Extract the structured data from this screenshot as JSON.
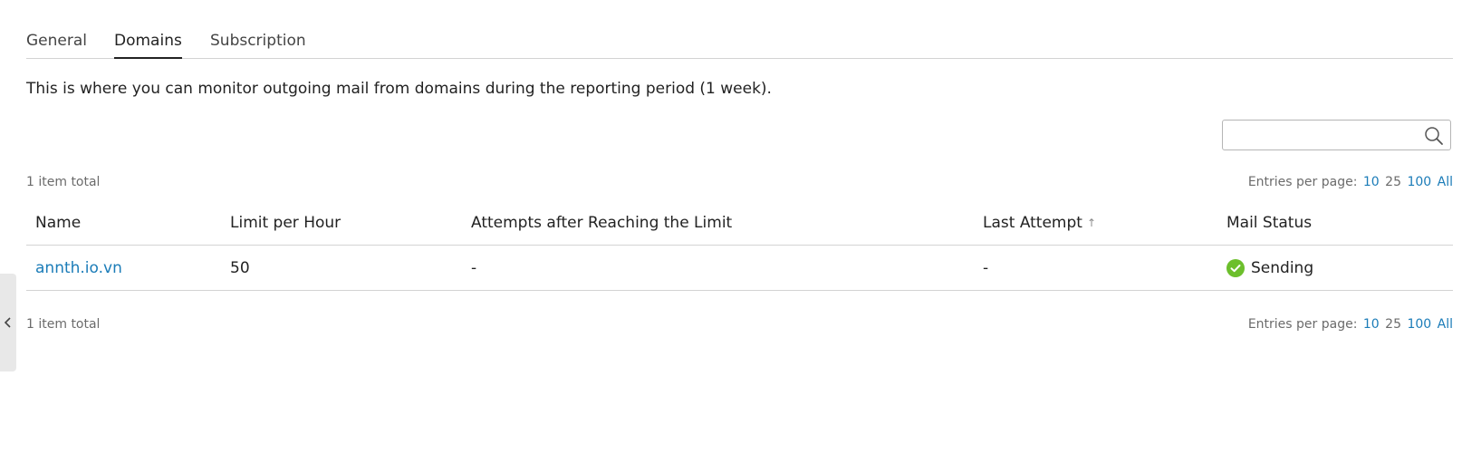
{
  "tabs": [
    {
      "label": "General",
      "active": false
    },
    {
      "label": "Domains",
      "active": true
    },
    {
      "label": "Subscription",
      "active": false
    }
  ],
  "description": "This is where you can monitor outgoing mail from domains during the reporting period (1 week).",
  "search": {
    "value": "",
    "placeholder": "",
    "icon": "search-icon"
  },
  "pager": {
    "total_label": "1 item total",
    "entries_label": "Entries per page:",
    "options": [
      "10",
      "25",
      "100",
      "All"
    ],
    "current": "25"
  },
  "table": {
    "columns": [
      "Name",
      "Limit per Hour",
      "Attempts after Reaching the Limit",
      "Last Attempt",
      "Mail Status"
    ],
    "sorted_column": "Last Attempt",
    "sort_direction": "ascending",
    "sort_icon": "arrow-up-icon",
    "rows": [
      {
        "name": "annth.io.vn",
        "limit_per_hour": "50",
        "attempts_after_limit": "-",
        "last_attempt": "-",
        "mail_status": "Sending",
        "status_icon": "check-circle-icon",
        "status_color": "#6cbf2c"
      }
    ]
  },
  "colors": {
    "link": "#1b7cb8",
    "border": "#d3d3d3",
    "muted_text": "#6b6b6b",
    "side_handle": "#e8e8e8"
  },
  "side_handle": {
    "icon": "chevron-left-icon"
  }
}
